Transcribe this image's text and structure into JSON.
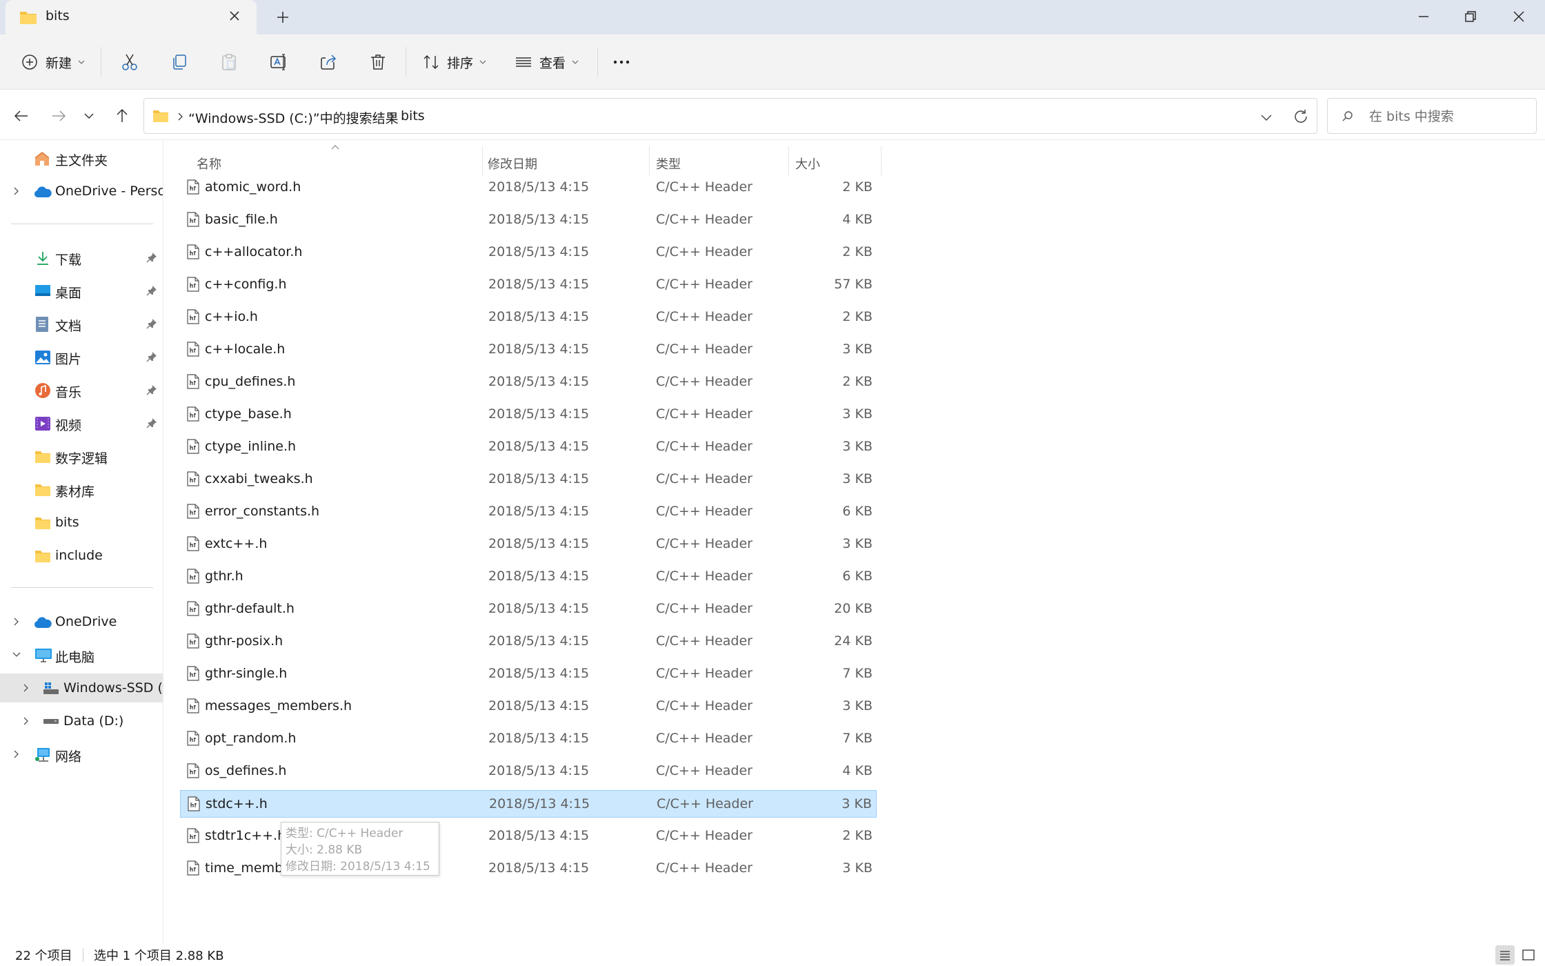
{
  "window": {
    "tab_title": "bits",
    "new_tab_symbol": "+"
  },
  "toolbar": {
    "new_label": "新建",
    "sort_label": "排序",
    "view_label": "查看"
  },
  "address": {
    "crumb_search": "“Windows-SSD (C:)”中的搜索结果",
    "crumb_current": "bits",
    "search_placeholder": "在 bits 中搜索"
  },
  "nav": {
    "home": "主文件夹",
    "onedrive_personal": "OneDrive - Persor",
    "quick_access": [
      {
        "label": "下载",
        "icon": "download-icon"
      },
      {
        "label": "桌面",
        "icon": "desktop-icon"
      },
      {
        "label": "文档",
        "icon": "documents-icon"
      },
      {
        "label": "图片",
        "icon": "pictures-icon"
      },
      {
        "label": "音乐",
        "icon": "music-icon"
      },
      {
        "label": "视频",
        "icon": "videos-icon"
      }
    ],
    "folders": [
      "数字逻辑",
      "素材库",
      "bits",
      "include"
    ],
    "onedrive": "OneDrive",
    "this_pc": "此电脑",
    "drive_c": "Windows-SSD (C",
    "drive_d": "Data (D:)",
    "network": "网络"
  },
  "columns": {
    "name": "名称",
    "date": "修改日期",
    "type": "类型",
    "size": "大小"
  },
  "files": [
    {
      "name": "atomic_word.h",
      "date": "2018/5/13 4:15",
      "type": "C/C++ Header",
      "size": "2 KB"
    },
    {
      "name": "basic_file.h",
      "date": "2018/5/13 4:15",
      "type": "C/C++ Header",
      "size": "4 KB"
    },
    {
      "name": "c++allocator.h",
      "date": "2018/5/13 4:15",
      "type": "C/C++ Header",
      "size": "2 KB"
    },
    {
      "name": "c++config.h",
      "date": "2018/5/13 4:15",
      "type": "C/C++ Header",
      "size": "57 KB"
    },
    {
      "name": "c++io.h",
      "date": "2018/5/13 4:15",
      "type": "C/C++ Header",
      "size": "2 KB"
    },
    {
      "name": "c++locale.h",
      "date": "2018/5/13 4:15",
      "type": "C/C++ Header",
      "size": "3 KB"
    },
    {
      "name": "cpu_defines.h",
      "date": "2018/5/13 4:15",
      "type": "C/C++ Header",
      "size": "2 KB"
    },
    {
      "name": "ctype_base.h",
      "date": "2018/5/13 4:15",
      "type": "C/C++ Header",
      "size": "3 KB"
    },
    {
      "name": "ctype_inline.h",
      "date": "2018/5/13 4:15",
      "type": "C/C++ Header",
      "size": "3 KB"
    },
    {
      "name": "cxxabi_tweaks.h",
      "date": "2018/5/13 4:15",
      "type": "C/C++ Header",
      "size": "3 KB"
    },
    {
      "name": "error_constants.h",
      "date": "2018/5/13 4:15",
      "type": "C/C++ Header",
      "size": "6 KB"
    },
    {
      "name": "extc++.h",
      "date": "2018/5/13 4:15",
      "type": "C/C++ Header",
      "size": "3 KB"
    },
    {
      "name": "gthr.h",
      "date": "2018/5/13 4:15",
      "type": "C/C++ Header",
      "size": "6 KB"
    },
    {
      "name": "gthr-default.h",
      "date": "2018/5/13 4:15",
      "type": "C/C++ Header",
      "size": "20 KB"
    },
    {
      "name": "gthr-posix.h",
      "date": "2018/5/13 4:15",
      "type": "C/C++ Header",
      "size": "24 KB"
    },
    {
      "name": "gthr-single.h",
      "date": "2018/5/13 4:15",
      "type": "C/C++ Header",
      "size": "7 KB"
    },
    {
      "name": "messages_members.h",
      "date": "2018/5/13 4:15",
      "type": "C/C++ Header",
      "size": "3 KB"
    },
    {
      "name": "opt_random.h",
      "date": "2018/5/13 4:15",
      "type": "C/C++ Header",
      "size": "7 KB"
    },
    {
      "name": "os_defines.h",
      "date": "2018/5/13 4:15",
      "type": "C/C++ Header",
      "size": "4 KB"
    },
    {
      "name": "stdc++.h",
      "date": "2018/5/13 4:15",
      "type": "C/C++ Header",
      "size": "3 KB",
      "selected": true
    },
    {
      "name": "stdtr1c++.h",
      "date": "2018/5/13 4:15",
      "type": "C/C++ Header",
      "size": "2 KB"
    },
    {
      "name": "time_members.h",
      "date": "2018/5/13 4:15",
      "type": "C/C++ Header",
      "size": "3 KB"
    }
  ],
  "tooltip": {
    "type": "类型: C/C++ Header",
    "size": "大小: 2.88 KB",
    "date": "修改日期: 2018/5/13 4:15"
  },
  "status": {
    "item_count": "22 个项目",
    "selection": "选中 1 个项目  2.88 KB"
  },
  "colors": {
    "selection_bg": "#cce8ff",
    "selection_border": "#99d1ff",
    "title_bar": "#dfe5ee",
    "folder": "#f5c242",
    "onedrive": "#1d7fd6"
  }
}
